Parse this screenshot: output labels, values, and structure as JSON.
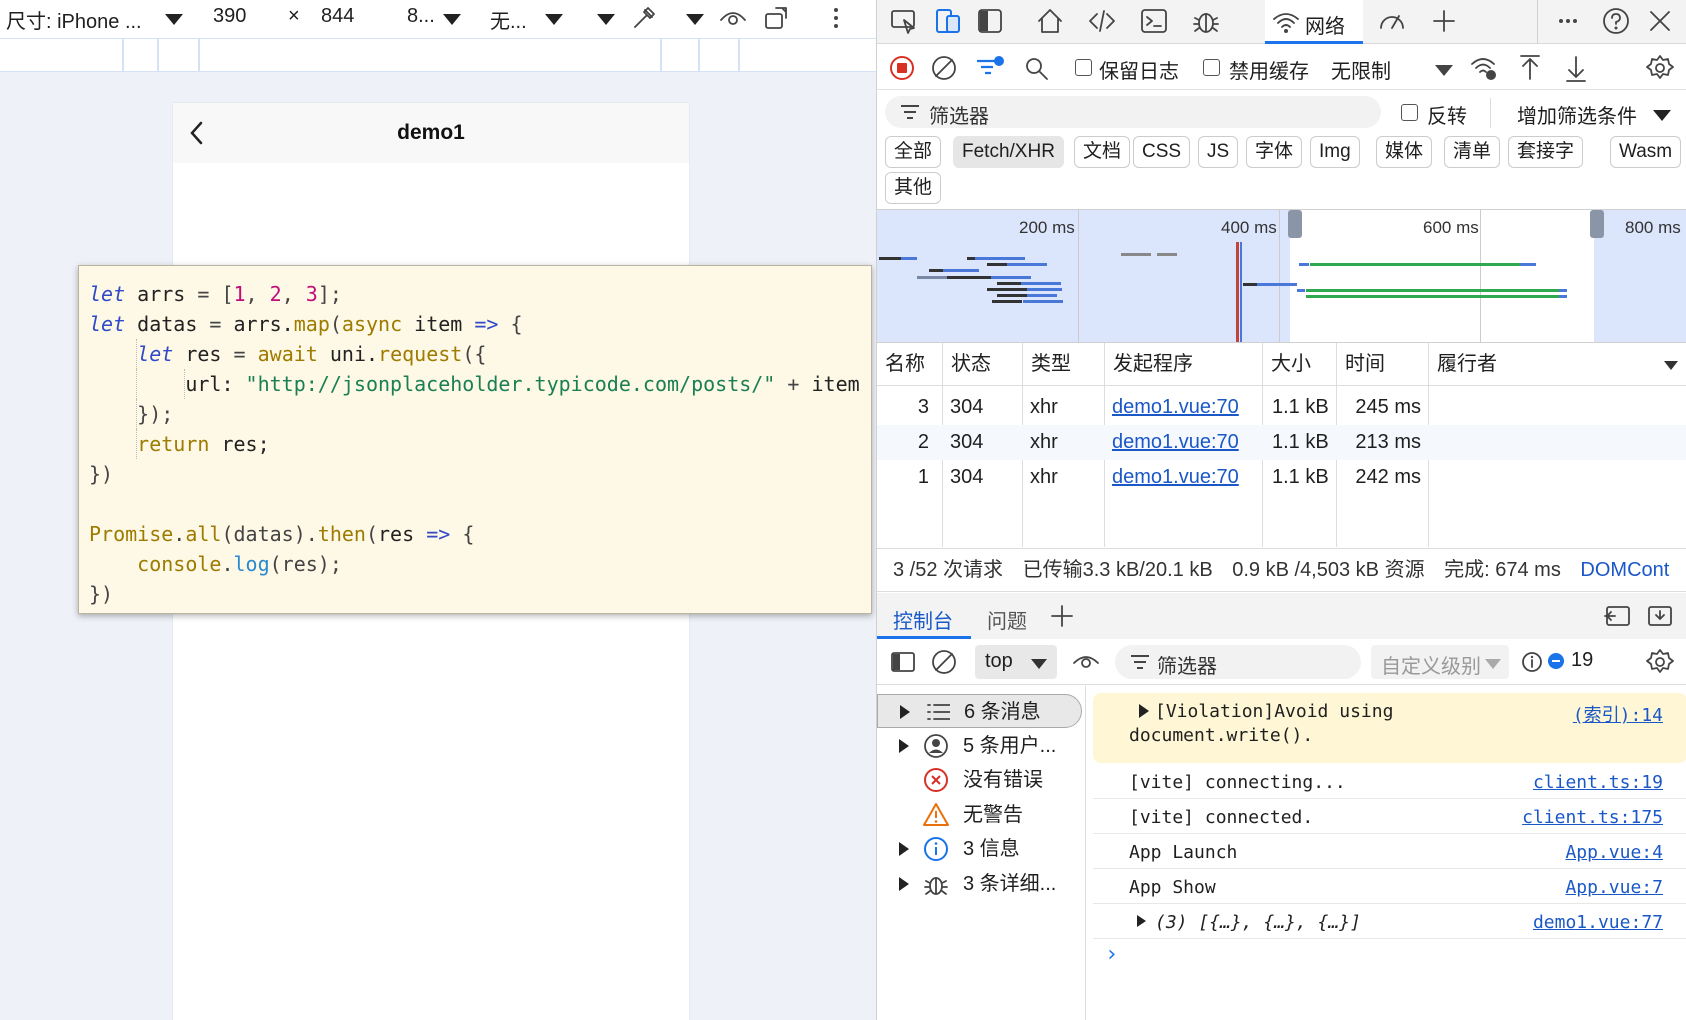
{
  "device_toolbar": {
    "dimensions_label": "尺寸: iPhone ...",
    "width": "390",
    "times": "×",
    "height": "844",
    "zoom": "8...",
    "throttle": "无..."
  },
  "phone": {
    "title": "demo1"
  },
  "code_lines": [
    [
      [
        "kw",
        "let"
      ],
      [
        "vr",
        " arrs "
      ],
      [
        "op",
        "= ["
      ],
      [
        "nm",
        "1"
      ],
      [
        "op",
        ", "
      ],
      [
        "nm",
        "2"
      ],
      [
        "op",
        ", "
      ],
      [
        "nm",
        "3"
      ],
      [
        "op",
        "];"
      ]
    ],
    [
      [
        "kw",
        "let"
      ],
      [
        "vr",
        " datas "
      ],
      [
        "op",
        "= "
      ],
      [
        "vr",
        "arrs."
      ],
      [
        "fn",
        "map"
      ],
      [
        "op",
        "("
      ],
      [
        "fn",
        "async"
      ],
      [
        "vr",
        " item "
      ],
      [
        "kw",
        "=>"
      ],
      [
        "op",
        " {"
      ]
    ],
    [
      [
        "vr",
        "    "
      ],
      [
        "kw",
        "let"
      ],
      [
        "vr",
        " res "
      ],
      [
        "op",
        "= "
      ],
      [
        "fn",
        "await"
      ],
      [
        "vr",
        " uni."
      ],
      [
        "fn",
        "request"
      ],
      [
        "op",
        "({"
      ]
    ],
    [
      [
        "vr",
        "        url: "
      ],
      [
        "st",
        "\"http://jsonplaceholder.typicode.com/posts/\""
      ],
      [
        "op",
        " + "
      ],
      [
        "vr",
        "item"
      ]
    ],
    [
      [
        "op",
        "    });"
      ]
    ],
    [
      [
        "vr",
        "    "
      ],
      [
        "fn",
        "return"
      ],
      [
        "vr",
        " res;"
      ]
    ],
    [
      [
        "op",
        "})"
      ]
    ],
    [
      [
        "vr",
        ""
      ]
    ],
    [
      [
        "fn",
        "Promise"
      ],
      [
        "op",
        "."
      ],
      [
        "fn",
        "all"
      ],
      [
        "op",
        "(datas)."
      ],
      [
        "fn",
        "then"
      ],
      [
        "op",
        "("
      ],
      [
        "vr",
        "res "
      ],
      [
        "kw",
        "=>"
      ],
      [
        "op",
        " {"
      ]
    ],
    [
      [
        "vr",
        "    "
      ],
      [
        "fn",
        "console"
      ],
      [
        "op",
        "."
      ],
      [
        "mt",
        "log"
      ],
      [
        "op",
        "(res);"
      ]
    ],
    [
      [
        "op",
        "})"
      ]
    ]
  ],
  "devtools": {
    "active_tab": "网络",
    "toolbar": {
      "preserve_log": "保留日志",
      "disable_cache": "禁用缓存",
      "throttling": "无限制"
    },
    "filter": {
      "placeholder": "筛选器",
      "invert": "反转",
      "more_filters": "增加筛选条件"
    },
    "type_filters": [
      "全部",
      "Fetch/XHR",
      "文档",
      "CSS",
      "JS",
      "字体",
      "Img",
      "媒体",
      "清单",
      "套接字",
      "Wasm",
      "其他"
    ],
    "active_filter": "Fetch/XHR",
    "timeline_ticks": [
      "200 ms",
      "400 ms",
      "600 ms",
      "800 ms"
    ],
    "columns": [
      "名称",
      "状态",
      "类型",
      "发起程序",
      "大小",
      "时间",
      "履行者"
    ],
    "requests": [
      {
        "name": "3",
        "status": "304",
        "type": "xhr",
        "initiator": "demo1.vue:70",
        "size": "1.1 kB",
        "time": "245 ms"
      },
      {
        "name": "2",
        "status": "304",
        "type": "xhr",
        "initiator": "demo1.vue:70",
        "size": "1.1 kB",
        "time": "213 ms"
      },
      {
        "name": "1",
        "status": "304",
        "type": "xhr",
        "initiator": "demo1.vue:70",
        "size": "1.1 kB",
        "time": "242 ms"
      }
    ],
    "summary": {
      "requests": "3 /52 次请求",
      "transferred": "已传输3.3 kB/20.1 kB",
      "resources": "0.9 kB /4,503 kB 资源",
      "finish": "完成: 674 ms",
      "domcontent": "DOMCont"
    }
  },
  "console": {
    "tabs": [
      "控制台",
      "问题"
    ],
    "context": "top",
    "filter_placeholder": "筛选器",
    "levels": "自定义级别",
    "issue_count": "19",
    "sidebar": [
      {
        "label": "6 条消息",
        "icon": "list-icon",
        "expandable": true
      },
      {
        "label": "5 条用户...",
        "icon": "user-icon",
        "expandable": true
      },
      {
        "label": "没有错误",
        "icon": "error-icon",
        "expandable": false
      },
      {
        "label": "无警告",
        "icon": "warning-icon",
        "expandable": false
      },
      {
        "label": "3 信息",
        "icon": "info-icon",
        "expandable": true
      },
      {
        "label": "3 条详细...",
        "icon": "bug-icon",
        "expandable": true
      }
    ],
    "messages": [
      {
        "text": "[Violation]Avoid using",
        "text2": "document.write().",
        "source": "(索引):14",
        "kind": "violation"
      },
      {
        "text": "[vite] connecting...",
        "source": "client.ts:19"
      },
      {
        "text": "[vite] connected.",
        "source": "client.ts:175"
      },
      {
        "text": "App Launch",
        "source": "App.vue:4"
      },
      {
        "text": "App Show",
        "source": "App.vue:7"
      },
      {
        "text": "(3) [{…}, {…}, {…}]",
        "source": "demo1.vue:77",
        "kind": "object"
      }
    ],
    "prompt": "›"
  }
}
